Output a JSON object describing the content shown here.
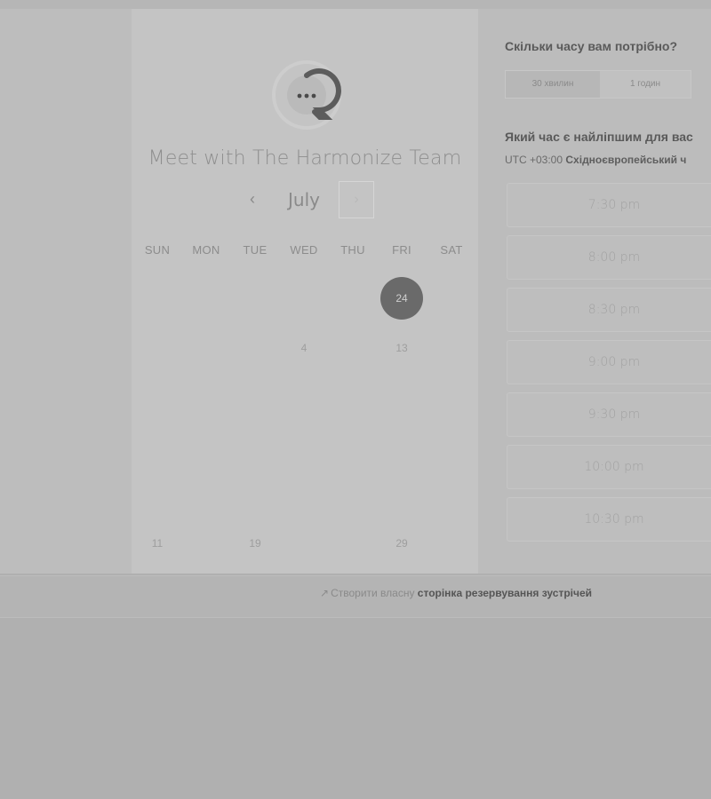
{
  "calendar": {
    "title": "Meet with The Harmonize Team",
    "month": "July",
    "prev_icon": "‹",
    "next_icon": "›",
    "weekdays": [
      "SUN",
      "MON",
      "TUE",
      "WED",
      "THU",
      "FRI",
      "SAT"
    ],
    "selected_day": "24",
    "days": [
      "4",
      "13",
      "11",
      "19",
      "29"
    ]
  },
  "booking": {
    "duration_question": "Скільки часу вам потрібно?",
    "durations": [
      "30 хвилин",
      "1 годин"
    ],
    "time_question": "Який час є найліпшим для вас",
    "timezone_offset": "UTC +03:00",
    "timezone_name": "Східноєвропейський ч",
    "slots": [
      "7:30 pm",
      "8:00 pm",
      "8:30 pm",
      "9:00 pm",
      "9:30 pm",
      "10:00 pm",
      "10:30 pm"
    ]
  },
  "footer": {
    "arrow_icon": "↗",
    "prefix": "Створити власну",
    "link": "сторінка резервування зустрічей"
  },
  "colors": {
    "selected_day_bg": "#6a6a6a",
    "logo_accent": "#5c5c5c"
  },
  "icons": {
    "logo": "chat-bubble-icon",
    "prev": "chevron-left-icon",
    "next": "chevron-right-icon",
    "footer": "arrow-icon"
  }
}
